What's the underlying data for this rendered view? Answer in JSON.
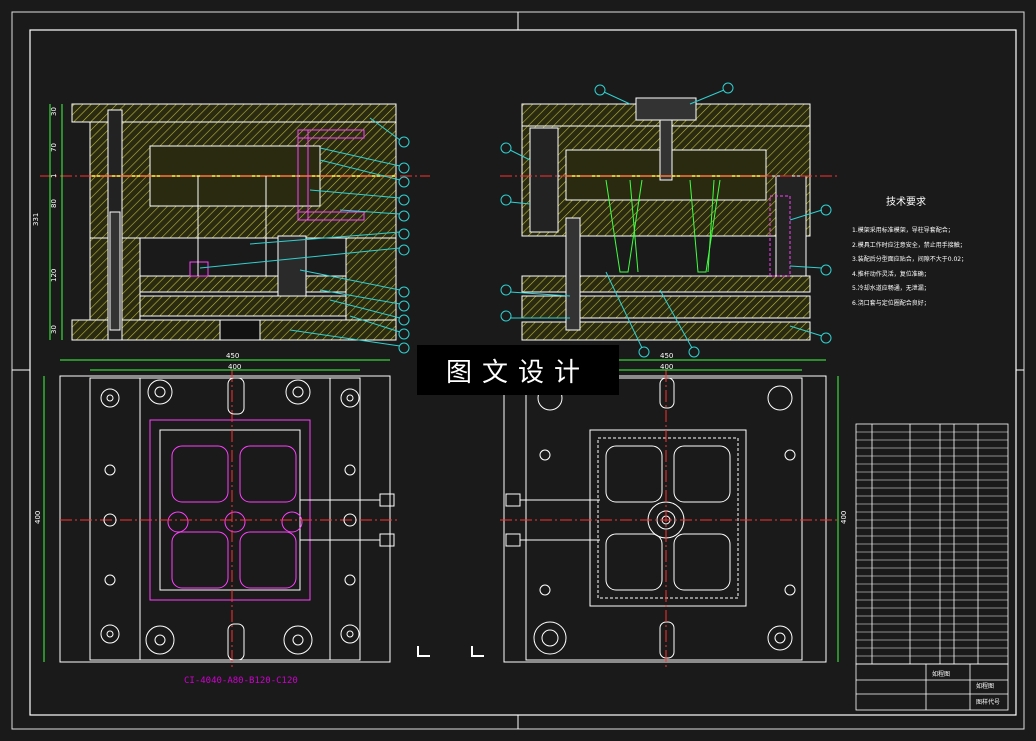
{
  "watermark": "图文设计",
  "technical_requirements": {
    "title": "技术要求",
    "lines": [
      "1.模架采用标准模架，导柱导套配合；",
      "2.模具工作时应注意安全，禁止用手接触；",
      "3.装配后分型面应贴合，间隙不大于0.02；",
      "4.推杆动作灵活，复位准确；",
      "5.冷却水道应畅通，无泄漏；",
      "6.浇口套与定位圈配合良好；"
    ]
  },
  "left_dims": {
    "width_outer": "450",
    "width_inner": "400",
    "height": "400",
    "total_height": "331"
  },
  "right_dims": {
    "width_outer": "450",
    "width_inner": "400",
    "height": "400"
  },
  "vertical_dims": [
    "30",
    "70",
    "1",
    "80",
    "120",
    "30"
  ],
  "mold_base_label": "CI-4040-A80-B120-C120",
  "title_block": {
    "name1": "如程图",
    "name2": "如程图",
    "drawing_no": "图样代号"
  },
  "colors": {
    "frame": "#ffffff",
    "hatch": "#c8c850",
    "center": "#ff3030",
    "leader": "#30d0d0",
    "part": "#ff40ff",
    "green": "#40ff40"
  }
}
